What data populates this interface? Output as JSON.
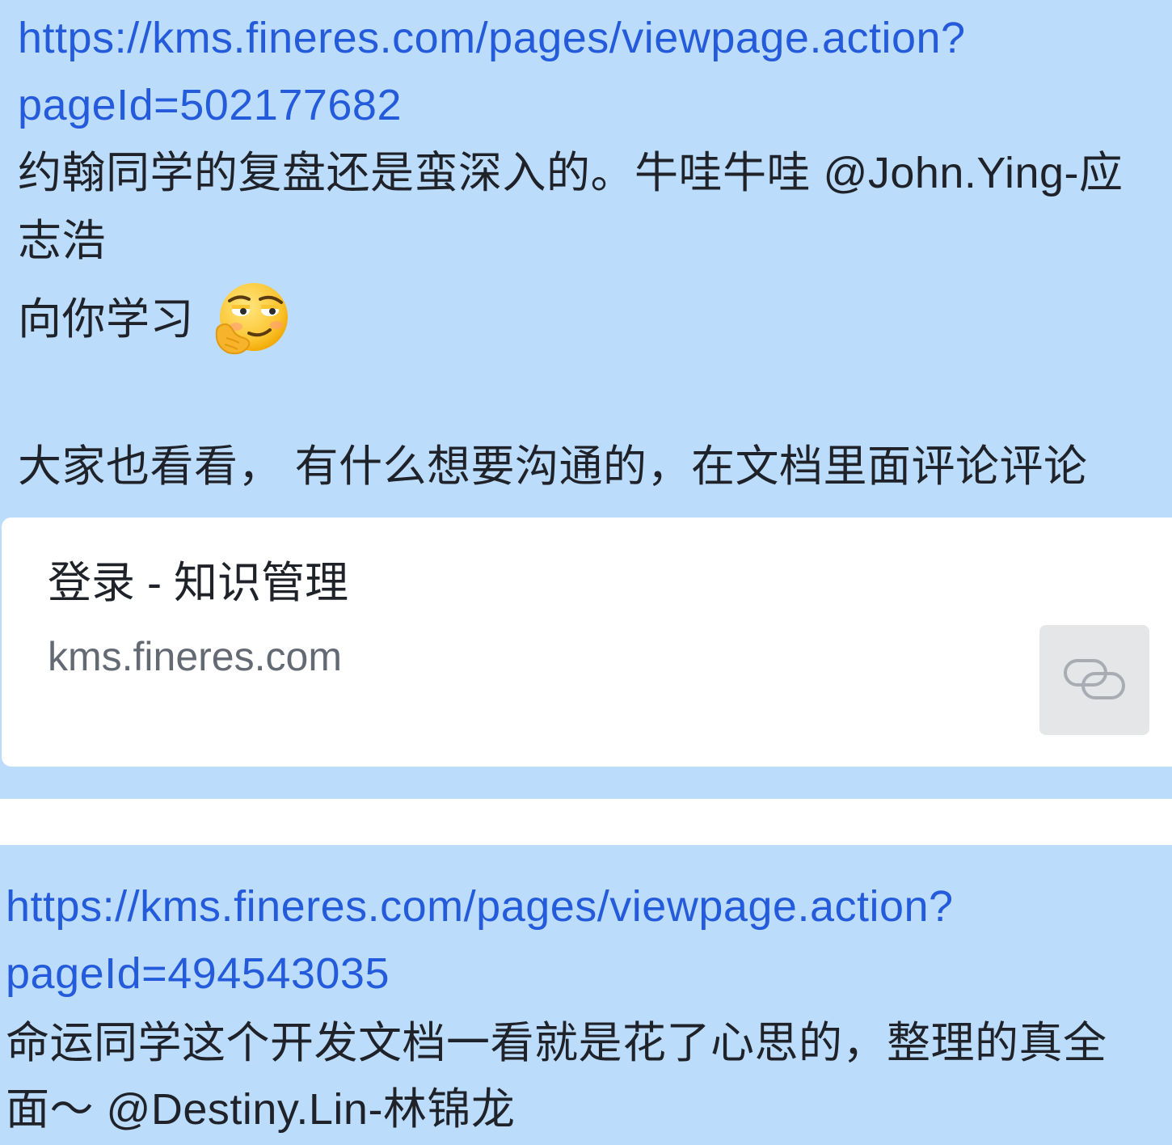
{
  "messages": [
    {
      "link_line1": "https://kms.fineres.com/pages/viewpage.action?",
      "link_line2": "pageId=502177682",
      "text_line1_prefix": "约翰同学的复盘还是蛮深入的。牛哇牛哇 ",
      "mention_part1": "@John.Ying-应",
      "mention_part2": "志浩",
      "text_line3": "向你学习",
      "emoji_icon": "thinking-smirk-emoji",
      "text_line4": "大家也看看， 有什么想要沟通的，在文档里面评论评论",
      "preview": {
        "title": "登录 - 知识管理",
        "domain": "kms.fineres.com",
        "thumb_icon": "link-icon"
      }
    },
    {
      "link_line1": "https://kms.fineres.com/pages/viewpage.action?",
      "link_line2": "pageId=494543035",
      "text_line1": "命运同学这个开发文档一看就是花了心思的，整理的真全",
      "text_line2": "面～ @Destiny.Lin-林锦龙"
    }
  ],
  "colors": {
    "bubble": "#bcdcfb",
    "link": "#245bdb",
    "text": "#1f2329",
    "card": "#ffffff",
    "secondary": "#646a73"
  }
}
